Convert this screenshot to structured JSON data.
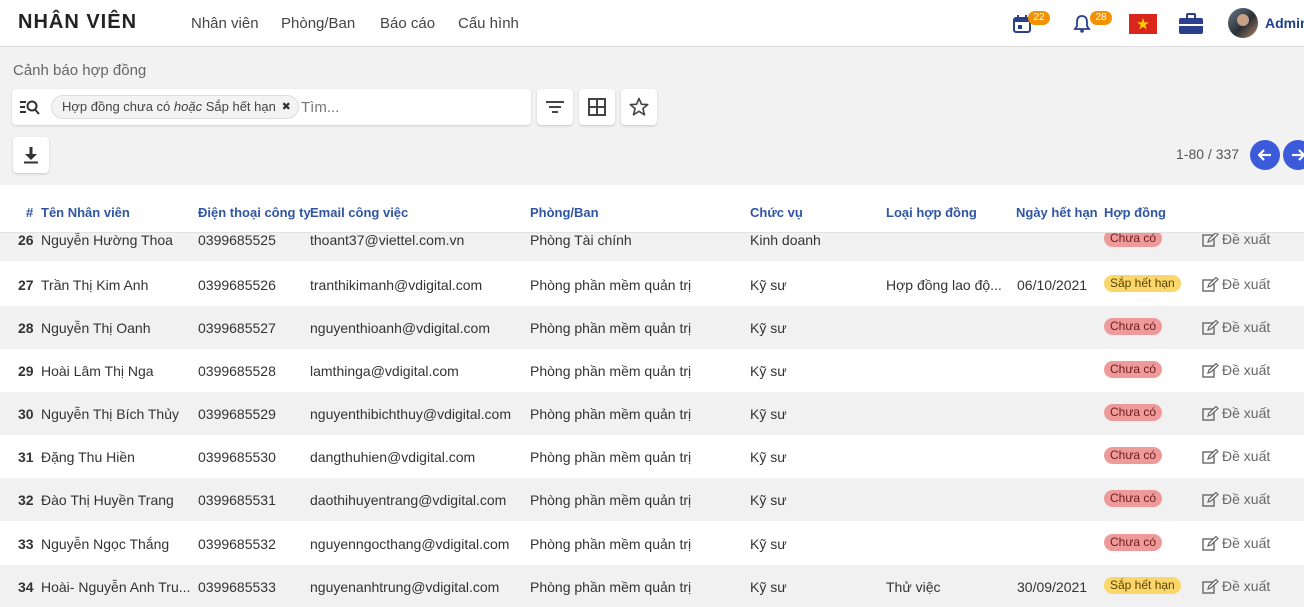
{
  "app": {
    "brand": "NHÂN VIÊN",
    "menu": [
      "Nhân viên",
      "Phòng/Ban",
      "Báo cáo",
      "Cấu hình"
    ],
    "calendar_badge": "22",
    "bell_badge": "28",
    "user": "Admin"
  },
  "control": {
    "breadcrumb": "Cảnh báo hợp đồng",
    "facet_part1": "Hợp đồng chưa có ",
    "facet_or": "hoặc",
    "facet_part2": " Sắp hết hạn",
    "search_placeholder": "Tìm...",
    "pager": "1-80 / 337"
  },
  "table": {
    "columns": [
      "#",
      "Tên Nhân viên",
      "Điện thoại công ty",
      "Email công việc",
      "Phòng/Ban",
      "Chức vụ",
      "Loại hợp đồng",
      "Ngày hết hạn",
      "Hợp đồng"
    ],
    "action_label": "Đề xuất",
    "rows": [
      {
        "num": "26",
        "name": "Nguyễn Hường Thoa",
        "phone": "0399685525",
        "email": "thoant37@viettel.com.vn",
        "dept": "Phòng Tài chính",
        "position": "Kinh doanh",
        "type": "",
        "expiry": "",
        "status": "Chưa có",
        "status_color": "red"
      },
      {
        "num": "27",
        "name": "Trần Thị Kim Anh",
        "phone": "0399685526",
        "email": "tranthikimanh@vdigital.com",
        "dept": "Phòng phần mềm quản trị",
        "position": "Kỹ sư",
        "type": "Hợp đồng lao độ...",
        "expiry": "06/10/2021",
        "status": "Sắp hết hạn",
        "status_color": "yellow"
      },
      {
        "num": "28",
        "name": "Nguyễn Thị Oanh",
        "phone": "0399685527",
        "email": "nguyenthioanh@vdigital.com",
        "dept": "Phòng phần mềm quản trị",
        "position": "Kỹ sư",
        "type": "",
        "expiry": "",
        "status": "Chưa có",
        "status_color": "red"
      },
      {
        "num": "29",
        "name": "Hoài Lâm Thị Nga",
        "phone": "0399685528",
        "email": "lamthinga@vdigital.com",
        "dept": "Phòng phần mềm quản trị",
        "position": "Kỹ sư",
        "type": "",
        "expiry": "",
        "status": "Chưa có",
        "status_color": "red"
      },
      {
        "num": "30",
        "name": "Nguyễn Thị Bích Thủy",
        "phone": "0399685529",
        "email": "nguyenthibichthuy@vdigital.com",
        "dept": "Phòng phần mềm quản trị",
        "position": "Kỹ sư",
        "type": "",
        "expiry": "",
        "status": "Chưa có",
        "status_color": "red"
      },
      {
        "num": "31",
        "name": "Đặng Thu Hiền",
        "phone": "0399685530",
        "email": "dangthuhien@vdigital.com",
        "dept": "Phòng phần mềm quản trị",
        "position": "Kỹ sư",
        "type": "",
        "expiry": "",
        "status": "Chưa có",
        "status_color": "red"
      },
      {
        "num": "32",
        "name": "Đào Thị Huyền Trang",
        "phone": "0399685531",
        "email": "daothihuyentrang@vdigital.com",
        "dept": "Phòng phần mềm quản trị",
        "position": "Kỹ sư",
        "type": "",
        "expiry": "",
        "status": "Chưa có",
        "status_color": "red"
      },
      {
        "num": "33",
        "name": "Nguyễn Ngọc Thắng",
        "phone": "0399685532",
        "email": "nguyenngocthang@vdigital.com",
        "dept": "Phòng phần mềm quản trị",
        "position": "Kỹ sư",
        "type": "",
        "expiry": "",
        "status": "Chưa có",
        "status_color": "red"
      },
      {
        "num": "34",
        "name": "Hoài- Nguyễn Anh Tru...",
        "phone": "0399685533",
        "email": "nguyenanhtrung@vdigital.com",
        "dept": "Phòng phần mềm quản trị",
        "position": "Kỹ sư",
        "type": "Thử việc",
        "expiry": "30/09/2021",
        "status": "Sắp hết hạn",
        "status_color": "yellow"
      }
    ]
  }
}
